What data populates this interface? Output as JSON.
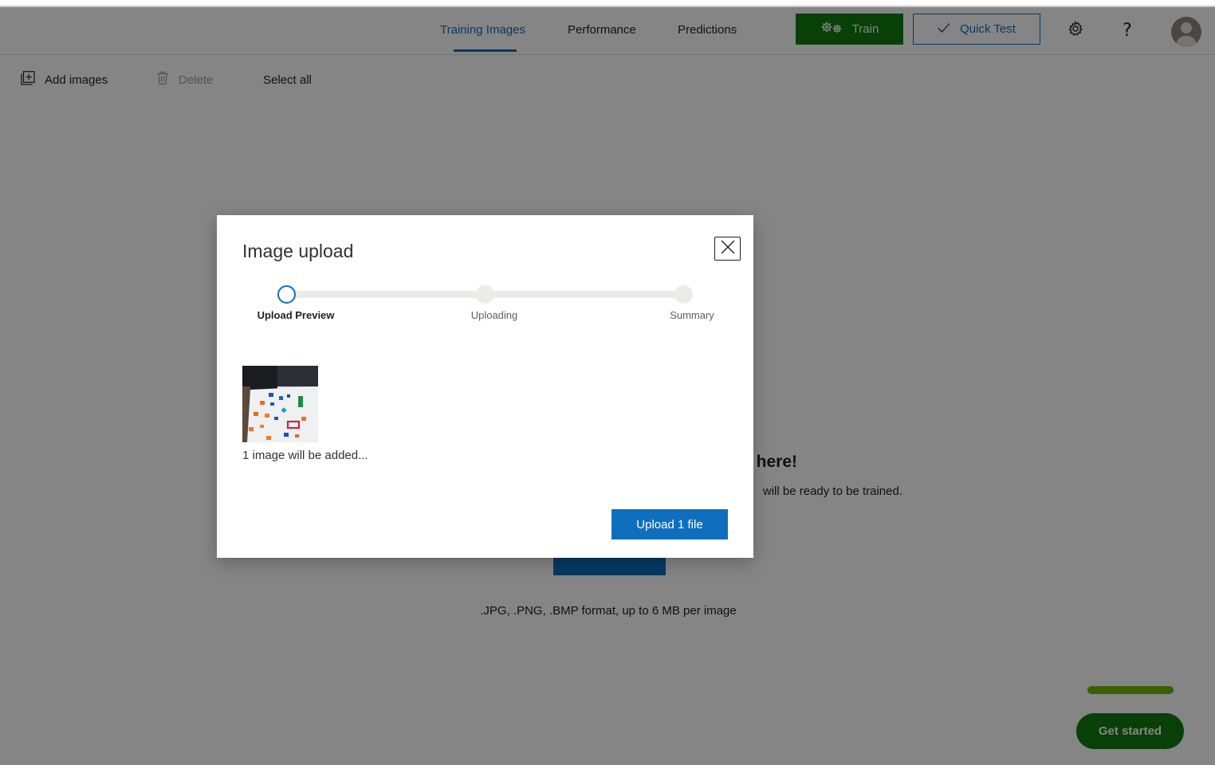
{
  "header": {
    "tabs": [
      {
        "label": "Training Images",
        "active": true
      },
      {
        "label": "Performance",
        "active": false
      },
      {
        "label": "Predictions",
        "active": false
      }
    ],
    "train_label": "Train",
    "quick_test_label": "Quick Test",
    "settings_icon": "gear-icon",
    "help_icon": "help-icon",
    "avatar_icon": "user-avatar-icon"
  },
  "command_bar": {
    "add_images_label": "Add images",
    "delete_label": "Delete",
    "select_all_label": "Select all"
  },
  "empty_state": {
    "title_visible": "here!",
    "subtitle_visible": "will be ready to be trained.",
    "formats": ".JPG, .PNG, .BMP format, up to 6 MB per image"
  },
  "get_started": {
    "label": "Get started"
  },
  "modal": {
    "title": "Image upload",
    "steps": [
      {
        "label": "Upload Preview",
        "active": true
      },
      {
        "label": "Uploading",
        "active": false
      },
      {
        "label": "Summary",
        "active": false
      }
    ],
    "caption": "1 image will be added...",
    "upload_button_label": "Upload 1 file"
  },
  "colors": {
    "accent_blue": "#106ebe",
    "train_green": "#107c10",
    "progress_green": "#6bb700"
  }
}
